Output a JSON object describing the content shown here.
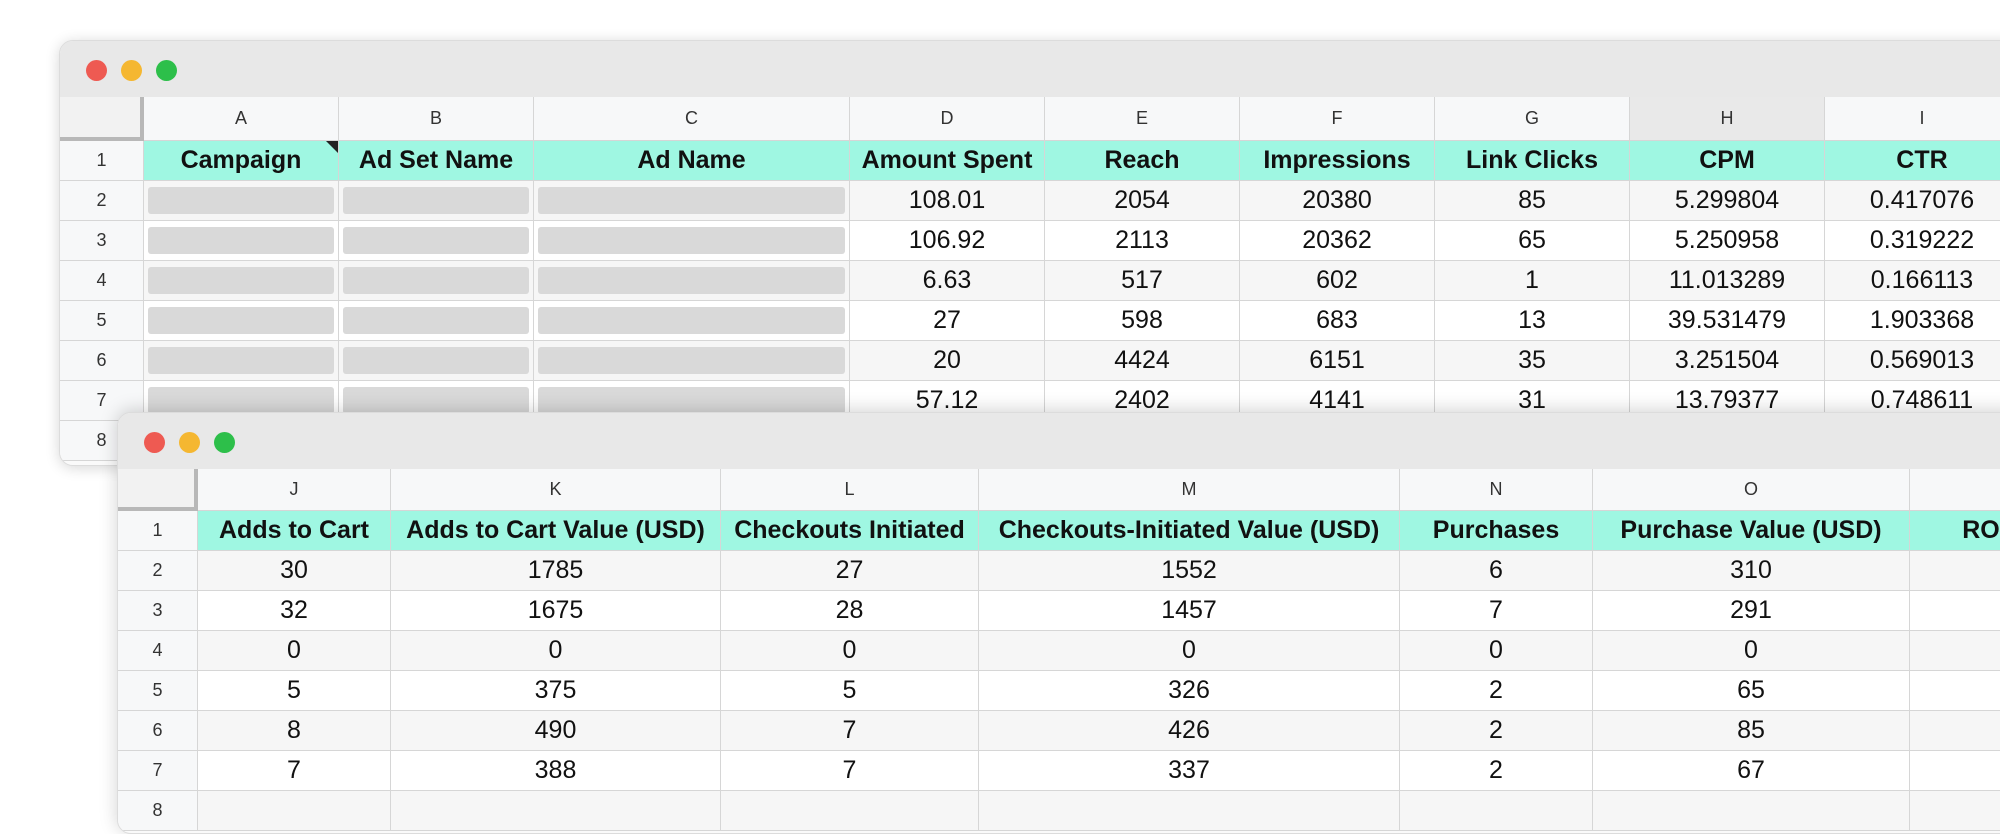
{
  "window1": {
    "columns": [
      "A",
      "B",
      "C",
      "D",
      "E",
      "F",
      "G",
      "H",
      "I"
    ],
    "headers": [
      "Campaign",
      "Ad Set Name",
      "Ad Name",
      "Amount Spent",
      "Reach",
      "Impressions",
      "Link Clicks",
      "CPM",
      "CTR"
    ],
    "row_numbers": [
      "1",
      "2",
      "3",
      "4",
      "5",
      "6",
      "7",
      "8"
    ],
    "rows": [
      [
        "",
        "",
        "",
        "108.01",
        "2054",
        "20380",
        "85",
        "5.299804",
        "0.417076"
      ],
      [
        "",
        "",
        "",
        "106.92",
        "2113",
        "20362",
        "65",
        "5.250958",
        "0.319222"
      ],
      [
        "",
        "",
        "",
        "6.63",
        "517",
        "602",
        "1",
        "11.013289",
        "0.166113"
      ],
      [
        "",
        "",
        "",
        "27",
        "598",
        "683",
        "13",
        "39.531479",
        "1.903368"
      ],
      [
        "",
        "",
        "",
        "20",
        "4424",
        "6151",
        "35",
        "3.251504",
        "0.569013"
      ],
      [
        "",
        "",
        "",
        "57.12",
        "2402",
        "4141",
        "31",
        "13.79377",
        "0.748611"
      ]
    ]
  },
  "window2": {
    "columns": [
      "J",
      "K",
      "L",
      "M",
      "N",
      "O",
      ""
    ],
    "headers": [
      "Adds to Cart",
      "Adds to Cart Value (USD)",
      "Checkouts Initiated",
      "Checkouts-Initiated Value (USD)",
      "Purchases",
      "Purchase Value (USD)",
      "ROAS ("
    ],
    "row_numbers": [
      "1",
      "2",
      "3",
      "4",
      "5",
      "6",
      "7",
      "8"
    ],
    "rows": [
      [
        "30",
        "1785",
        "27",
        "1552",
        "6",
        "310",
        ""
      ],
      [
        "32",
        "1675",
        "28",
        "1457",
        "7",
        "291",
        ""
      ],
      [
        "0",
        "0",
        "0",
        "0",
        "0",
        "0",
        ""
      ],
      [
        "5",
        "375",
        "5",
        "326",
        "2",
        "65",
        ""
      ],
      [
        "8",
        "490",
        "7",
        "426",
        "2",
        "85",
        ""
      ],
      [
        "7",
        "388",
        "7",
        "337",
        "2",
        "67",
        ""
      ]
    ]
  },
  "colors": {
    "header_fill": "#9ff7e2",
    "close": "#ee5a52",
    "minimize": "#f5b731",
    "zoom": "#2dbf4a"
  }
}
